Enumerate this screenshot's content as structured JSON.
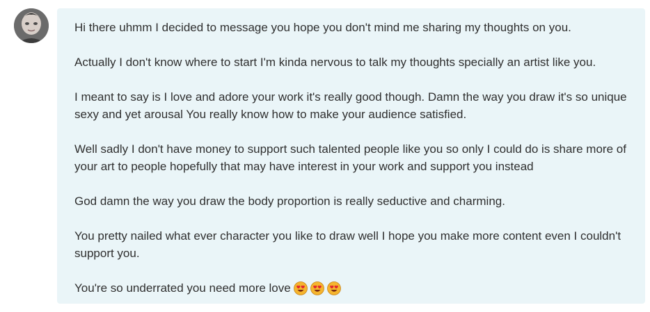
{
  "message": {
    "avatar_icon": "user-avatar-photo",
    "paragraphs": [
      "Hi there uhmm I decided to message you hope you don't mind me sharing my thoughts on you.",
      "Actually I don't know where to start I'm kinda nervous to talk my thoughts specially an artist like you.",
      "I meant to say is I love and adore your work it's really good though. Damn the way you draw it's so unique sexy and yet arousal You really know how to make your audience satisfied.",
      "Well sadly I don't have money to support such talented people like you so only I could do is share more of your art to people hopefully that may have interest in your work and support you instead",
      "God damn the way you draw the body proportion is really seductive and charming.",
      "You pretty nailed what ever character you like to draw well I hope you make more content even I couldn't support you.",
      "You're so underrated you need more love"
    ],
    "emoji_icons": [
      "heart-eyes-emoji-icon",
      "heart-eyes-emoji-icon",
      "heart-eyes-emoji-icon"
    ]
  },
  "colors": {
    "bubble_background": "#eaf5f8",
    "text": "#2f2f2f"
  }
}
